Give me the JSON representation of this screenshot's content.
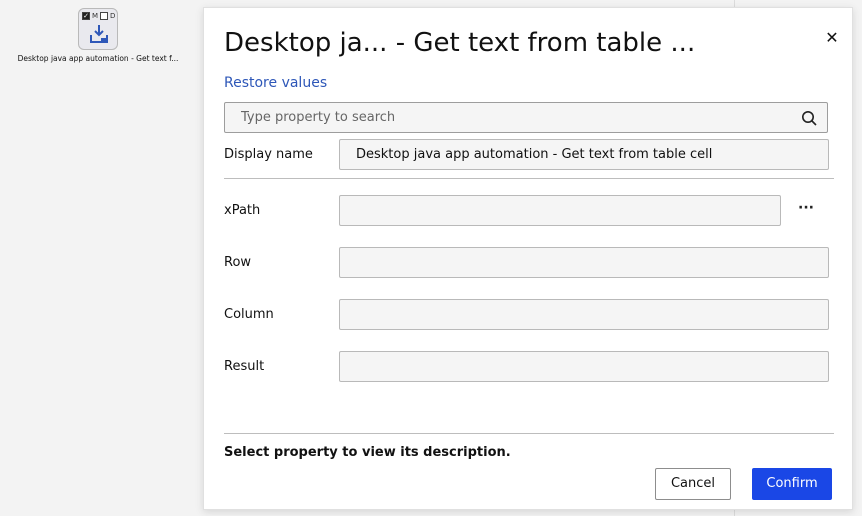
{
  "canvas_node": {
    "flags": [
      {
        "name": "checkbox-checked",
        "label": "",
        "checked": true
      },
      {
        "name": "flag-m",
        "label": "M"
      },
      {
        "name": "checkbox-unchecked",
        "label": "",
        "checked": false
      },
      {
        "name": "flag-d",
        "label": "D"
      }
    ],
    "flag_m": "M",
    "flag_d": "D",
    "icon": "download-tray-icon",
    "label": "Desktop java app automation - Get text f..."
  },
  "dialog": {
    "title": "Desktop ja... - Get text from table ...",
    "close_icon": "close-icon",
    "restore_label": "Restore values",
    "search": {
      "placeholder": "Type property to search",
      "value": "",
      "icon": "search-icon"
    },
    "display_name": {
      "label": "Display name",
      "value": "Desktop java app automation - Get text from table cell"
    },
    "properties": [
      {
        "label": "xPath",
        "value": ""
      },
      {
        "label": "Row",
        "value": ""
      },
      {
        "label": "Column",
        "value": ""
      },
      {
        "label": "Result",
        "value": ""
      }
    ],
    "xpath_more": "···",
    "description": "Select property to view its description.",
    "cancel_label": "Cancel",
    "confirm_label": "Confirm",
    "colors": {
      "accent": "#1a47e6",
      "link": "#2e57b8"
    }
  }
}
